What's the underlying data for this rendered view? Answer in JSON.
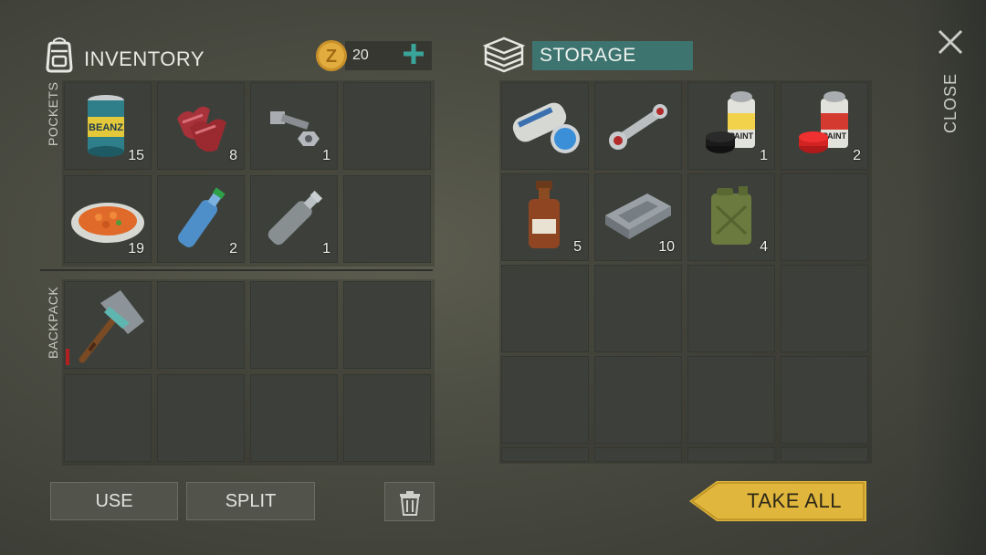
{
  "header": {
    "inventory_title": "INVENTORY",
    "coin_count": "20",
    "storage_title": "STORAGE",
    "close_label": "CLOSE"
  },
  "sections": {
    "pockets_label": "POCKETS",
    "backpack_label": "BACKPACK"
  },
  "pockets": [
    {
      "item": "canned-beans-icon",
      "qty": "15"
    },
    {
      "item": "raw-meat-icon",
      "qty": "8"
    },
    {
      "item": "bolt-and-nut-icon",
      "qty": "1"
    },
    {
      "item": "empty",
      "qty": ""
    },
    {
      "item": "cooked-food-plate-icon",
      "qty": "19"
    },
    {
      "item": "water-bottle-icon",
      "qty": "2"
    },
    {
      "item": "empty-bottle-icon",
      "qty": "1"
    },
    {
      "item": "empty",
      "qty": ""
    }
  ],
  "backpack": [
    {
      "item": "stone-hammer-icon",
      "qty": ""
    }
  ],
  "storage": [
    {
      "item": "newspaper-and-tape-icon",
      "qty": ""
    },
    {
      "item": "connecting-rod-icon",
      "qty": ""
    },
    {
      "item": "black-spray-paint-icon",
      "qty": "1"
    },
    {
      "item": "red-spray-paint-icon",
      "qty": "2"
    },
    {
      "item": "medicine-bottle-icon",
      "qty": "5"
    },
    {
      "item": "metal-plate-icon",
      "qty": "10"
    },
    {
      "item": "jerrycan-icon",
      "qty": "4"
    }
  ],
  "actions": {
    "use_label": "USE",
    "split_label": "SPLIT",
    "take_all_label": "TAKE ALL"
  },
  "colors": {
    "storage_header": "#3d7470",
    "plus_accent": "#3aa39a",
    "take_all": "#e0b63c",
    "slot": "#3d403a"
  }
}
